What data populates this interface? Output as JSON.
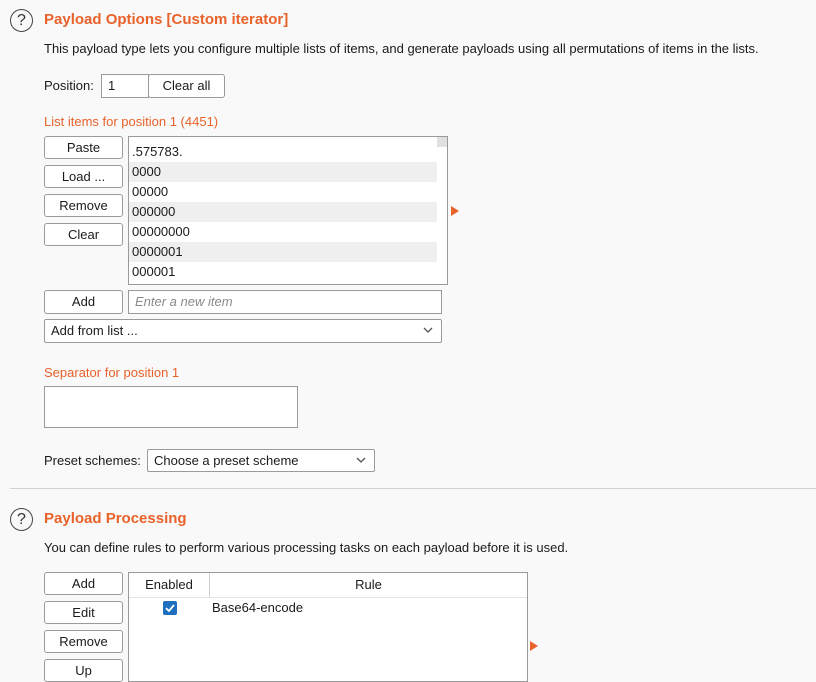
{
  "payload_options": {
    "help_glyph": "?",
    "title": "Payload Options [Custom iterator]",
    "description": "This payload type lets you configure multiple lists of items, and generate payloads using all permutations of items in the lists.",
    "position_label": "Position:",
    "position_value": "1",
    "clear_all_label": "Clear all",
    "list_title": "List items for position 1 (4451)",
    "buttons": {
      "paste": "Paste",
      "load": "Load ...",
      "remove": "Remove",
      "clear": "Clear",
      "add": "Add"
    },
    "list_items": [
      ".575783.",
      "0000",
      "00000",
      "000000",
      "00000000",
      "0000001",
      "000001"
    ],
    "new_item_placeholder": "Enter a new item",
    "add_from_list_label": "Add from list ...",
    "separator_label": "Separator for position 1",
    "separator_value": "",
    "preset_label": "Preset schemes:",
    "preset_value": "Choose a preset scheme"
  },
  "payload_processing": {
    "help_glyph": "?",
    "title": "Payload Processing",
    "description": "You can define rules to perform various processing tasks on each payload before it is used.",
    "buttons": {
      "add": "Add",
      "edit": "Edit",
      "remove": "Remove",
      "up": "Up"
    },
    "columns": {
      "enabled": "Enabled",
      "rule": "Rule"
    },
    "rules": [
      {
        "enabled": true,
        "rule": "Base64-encode"
      }
    ]
  },
  "colors": {
    "accent": "#e8622a",
    "checkbox": "#1f6fbf"
  }
}
